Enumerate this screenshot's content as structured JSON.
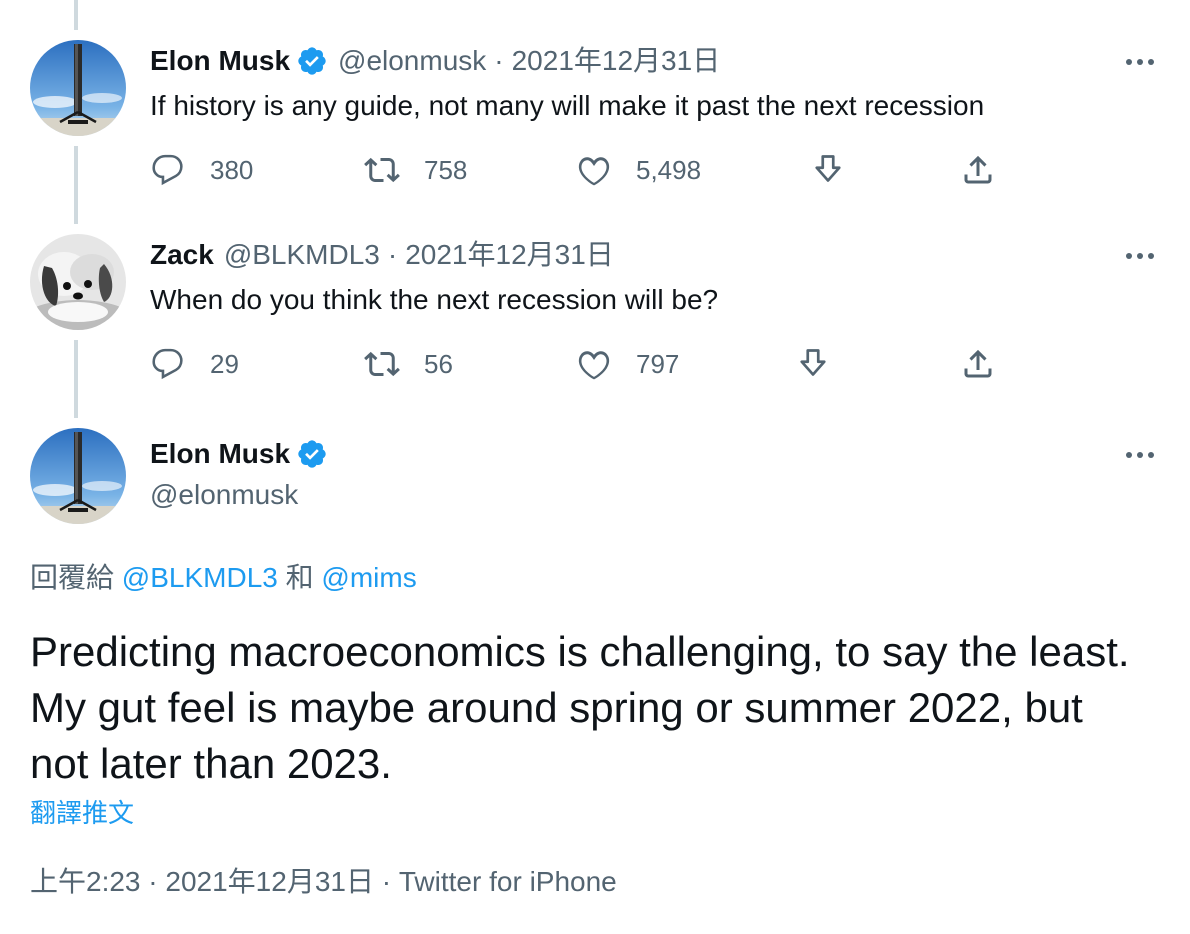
{
  "thread": [
    {
      "name": "Elon Musk",
      "verified": true,
      "handle": "@elonmusk",
      "separator": "·",
      "date": "2021年12月31日",
      "text": "If history is any guide, not many will make it past the next recession",
      "replies": "380",
      "retweets": "758",
      "likes": "5,498"
    },
    {
      "name": "Zack",
      "verified": false,
      "handle": "@BLKMDL3",
      "separator": "·",
      "date": "2021年12月31日",
      "text": "When do you think the next recession will be?",
      "replies": "29",
      "retweets": "56",
      "likes": "797"
    }
  ],
  "main": {
    "name": "Elon Musk",
    "handle": "@elonmusk",
    "reply_prefix": "回覆給",
    "mention_1": "@BLKMDL3",
    "conjunction": "和",
    "mention_2": "@mims",
    "text": "Predicting macroeconomics is challenging, to say the least. My gut feel is maybe around spring or summer 2022, but not later than 2023.",
    "translate_label": "翻譯推文",
    "time": "上午2:23",
    "date": "2021年12月31日",
    "separator": "·",
    "source": "Twitter for iPhone"
  },
  "icons": {
    "reply": "reply-icon",
    "retweet": "retweet-icon",
    "like": "heart-icon",
    "bookmark": "download-icon",
    "share": "share-icon",
    "more": "more-icon",
    "verified": "verified-badge-icon"
  },
  "colors": {
    "accent": "#1d9bf0",
    "text": "#0f1419",
    "secondary": "#536471",
    "thread_line": "#cfd9de"
  }
}
